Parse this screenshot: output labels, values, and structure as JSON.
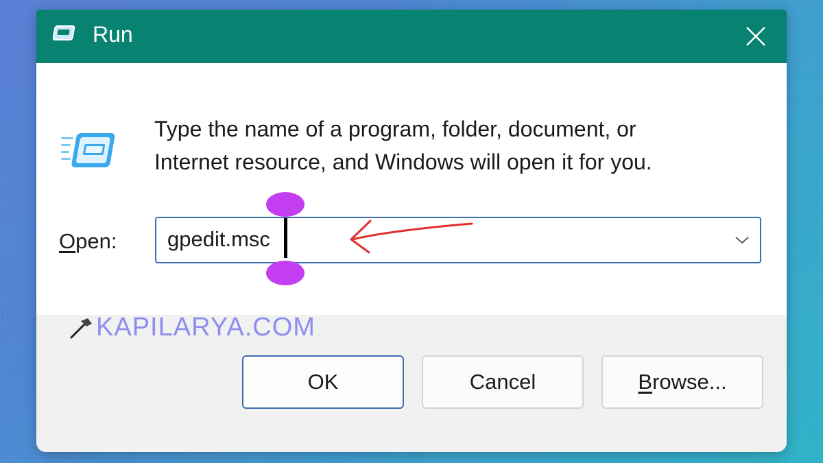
{
  "window": {
    "title": "Run",
    "close_glyph": "✕"
  },
  "dialog": {
    "description_line1": "Type the name of a program, folder, document, or",
    "description_line2": "Internet resource, and Windows will open it for you.",
    "open_label_underlined": "O",
    "open_label_rest": "pen:",
    "open_value": "gpedit.msc"
  },
  "buttons": {
    "ok": "OK",
    "cancel": "Cancel",
    "browse_underlined": "B",
    "browse_rest": "rowse..."
  },
  "watermark": {
    "text": "KAPILARYA.COM"
  },
  "icons": {
    "title": "run-window-icon",
    "dialog": "run-dialog-icon",
    "close": "close-icon",
    "dropdown": "chevron-down-icon",
    "watermark": "hammer-icon",
    "annotation": "red-arrow-annotation"
  },
  "colors": {
    "titlebar": "#088271",
    "accent_border": "#3d6fb0",
    "watermark": "#8d8df0",
    "annotation_arrow": "#e0302e",
    "cursor_marker": "#c23ef0"
  }
}
